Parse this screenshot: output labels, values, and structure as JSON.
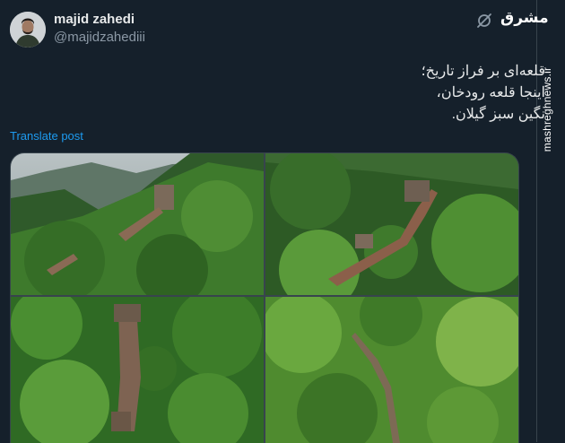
{
  "tweet": {
    "author_name": "majid zahedi",
    "author_handle": "@majidzahediii",
    "text": "قلعه‌ای بر فراز تاریخ؛\nاینجا قلعه رودخان،\nنگین سبز گیلان.",
    "translate_label": "Translate post",
    "image_count": 4
  },
  "watermark": {
    "logo_text": "مشرق",
    "site": "mashreghnews.ir"
  },
  "icons": {
    "author_avatar": "avatar",
    "top_right": "grok-icon"
  },
  "colors": {
    "background": "#15202b",
    "text_primary": "#e7e9ea",
    "text_secondary": "#8b98a5",
    "link": "#1d9bf0",
    "border": "#38444d"
  }
}
